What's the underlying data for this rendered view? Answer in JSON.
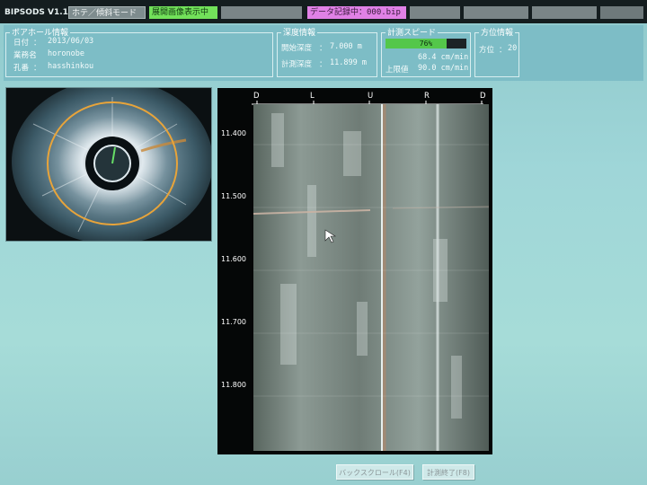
{
  "top_bar": {
    "app_title": "BIPSODS V1.17",
    "mode_label": "ホテ／傾斜モード",
    "display_status": "展開画像表示中",
    "record_status": "データ記録中：000.bip"
  },
  "borehole_info": {
    "title": "ボアホール情報",
    "date_label": "日付",
    "date_value": "2013/06/03",
    "business_label": "業務名",
    "business_value": "horonobe",
    "hole_label": "孔番",
    "hole_value": "hasshinkou"
  },
  "depth_info": {
    "title": "深度情報",
    "start_label": "開始深度",
    "start_value": "7.000 m",
    "measure_label": "計測深度",
    "measure_value": "11.899 m"
  },
  "speed_info": {
    "title": "計測スピード",
    "percent": 76,
    "percent_label": "76%",
    "speed_value": "68.4 cm/min",
    "limit_label": "上限値",
    "limit_value": "90.0 cm/min"
  },
  "direction_info": {
    "title": "方位情報",
    "label": "方位",
    "value": "20"
  },
  "scan": {
    "directions": [
      "D",
      "L",
      "U",
      "R",
      "D"
    ],
    "depth_ticks": [
      "11.400",
      "11.500",
      "11.600",
      "11.700",
      "11.800"
    ]
  },
  "buttons": {
    "back_scroll": "バックスクロール(F4)",
    "end_measure": "計測終了(F8)"
  },
  "colors": {
    "background": "#9fd6d8",
    "status_green": "#72e15a",
    "status_pink": "#e081e6",
    "speed_green": "#54c74a",
    "ring_orange": "#e8a43a"
  }
}
